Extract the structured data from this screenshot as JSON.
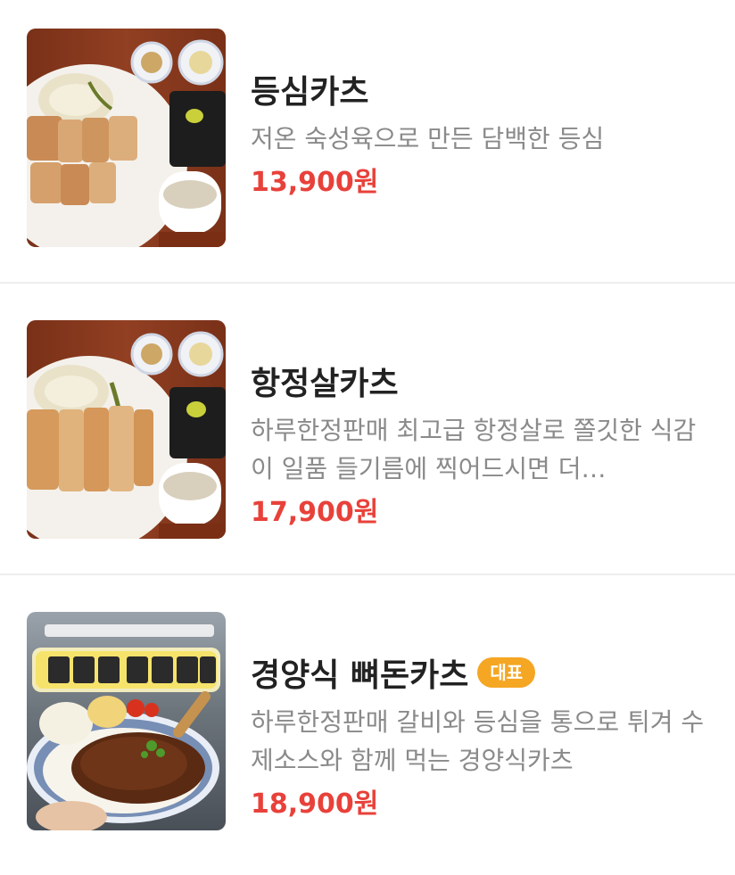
{
  "menu": {
    "items": [
      {
        "name": "등심카츠",
        "description": "저온 숙성육으로 만든 담백한 등심",
        "price": "13,900원",
        "badge": null,
        "image_icon": "pork-cutlet-plate-photo"
      },
      {
        "name": "항정살카츠",
        "description": "하루한정판매 최고급 항정살로 쫄깃한 식감이 일품 들기름에 찍어드시면 더…",
        "price": "17,900원",
        "badge": null,
        "image_icon": "pork-cutlet-plate-photo"
      },
      {
        "name": "경양식 뼈돈카츠",
        "description": "하루한정판매 갈비와 등심을 통으로 튀겨 수제소스와 함께 먹는 경양식카츠",
        "price": "18,900원",
        "badge": "대표",
        "image_icon": "bone-in-cutlet-photo"
      }
    ]
  },
  "colors": {
    "price": "#e8413a",
    "badge": "#f5a623",
    "name": "#222222",
    "description": "#8a8a8a",
    "divider": "#eeeeee"
  }
}
